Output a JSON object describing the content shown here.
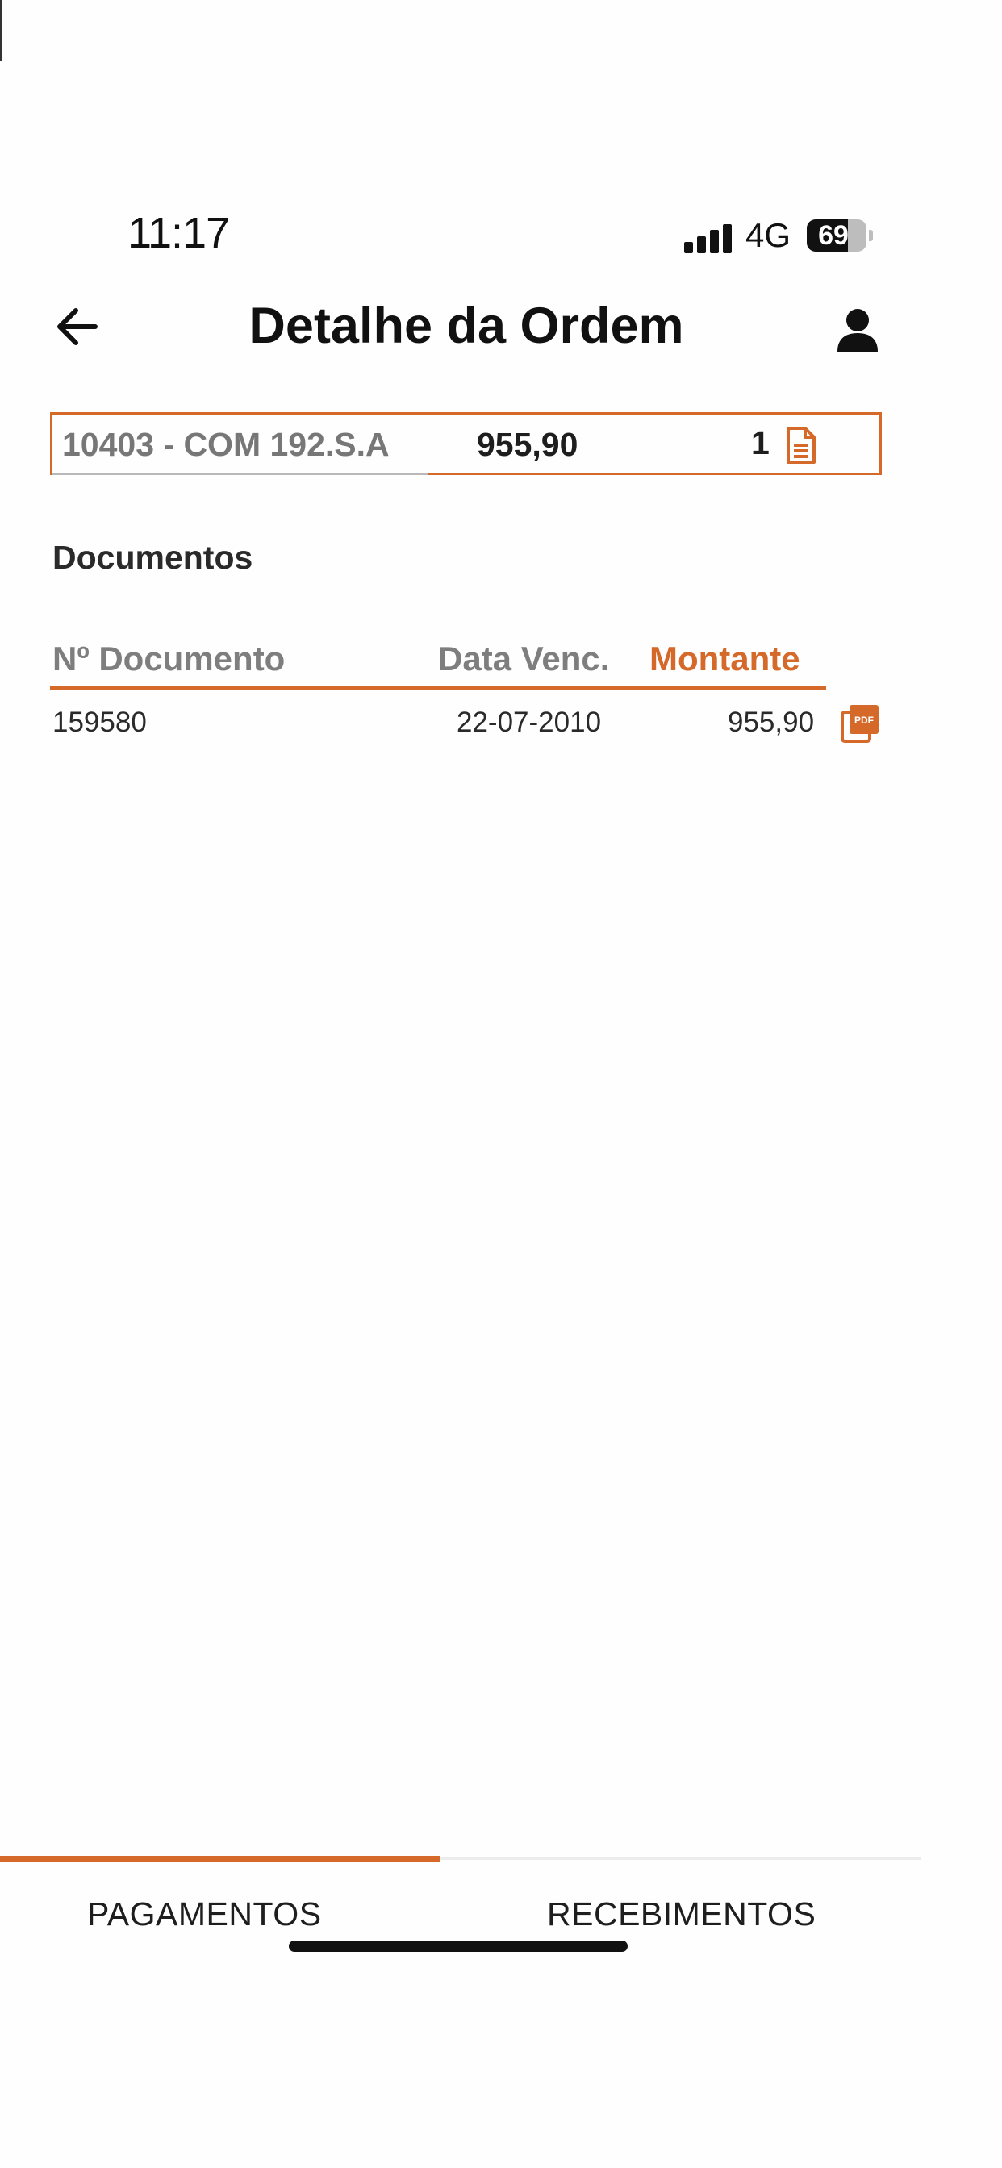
{
  "status_bar": {
    "time": "11:17",
    "network": "4G",
    "battery": "69",
    "battery_level_percent": 69
  },
  "header": {
    "title": "Detalhe da Ordem",
    "back_icon": "arrow-left-icon",
    "profile_icon": "user-icon"
  },
  "order": {
    "name": "10403 - COM 192.S.A",
    "amount": "955,90",
    "document_count": "1",
    "document_icon": "file-text-icon"
  },
  "documents": {
    "section_title": "Documentos",
    "columns": [
      "Nº Documento",
      "Data Venc.",
      "Montante"
    ],
    "rows": [
      {
        "number": "159580",
        "due_date": "22-07-2010",
        "amount": "955,90",
        "icon": "pdf-icon"
      }
    ]
  },
  "tabs": [
    {
      "label": "PAGAMENTOS",
      "active": true
    },
    {
      "label": "RECEBIMENTOS",
      "active": false
    }
  ],
  "colors": {
    "accent": "#d4692a",
    "muted_text": "#7e7e7e",
    "text": "#1e1e1e"
  }
}
